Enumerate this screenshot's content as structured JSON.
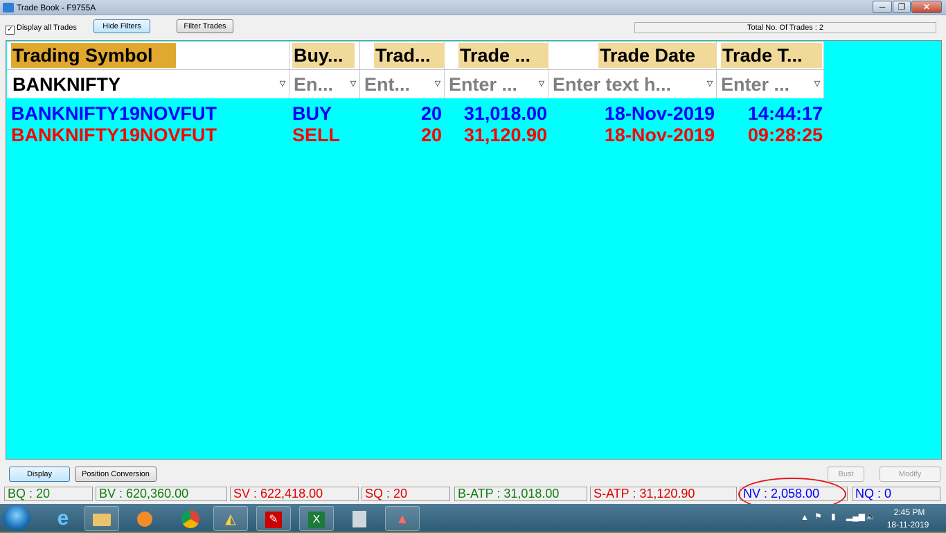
{
  "window": {
    "title": "Trade Book - F9755A",
    "minimize": "─",
    "maximize": "❐",
    "close": "✕"
  },
  "toolbar": {
    "display_all_label": "Display all Trades",
    "display_all_checked": "✓",
    "hide_filters_label": "Hide Filters",
    "filter_trades_label": "Filter Trades",
    "total_trades_label": "Total No. Of Trades : 2"
  },
  "grid": {
    "columns": [
      "Trading Symbol",
      "Buy...",
      "Trad...",
      "Trade ...",
      "Trade Date",
      "Trade T..."
    ],
    "filters": [
      "BANKNIFTY",
      "En...",
      "Ent...",
      "Enter ...",
      "Enter text h...",
      "Enter ..."
    ],
    "filter_icon": "▽",
    "rows": [
      {
        "symbol": "BANKNIFTY19NOVFUT",
        "side": "BUY",
        "qty": "20",
        "price": "31,018.00",
        "date": "18-Nov-2019",
        "time": "14:44:17",
        "color": "#0000ff"
      },
      {
        "symbol": "BANKNIFTY19NOVFUT",
        "side": "SELL",
        "qty": "20",
        "price": "31,120.90",
        "date": "18-Nov-2019",
        "time": "09:28:25",
        "color": "#ff0000"
      }
    ]
  },
  "actions": {
    "display_label": "Display",
    "position_conversion_label": "Position Conversion",
    "bust_label": "Bust",
    "modify_label": "Modify"
  },
  "status": {
    "bq": "BQ : 20",
    "bv": "BV : 620,360.00",
    "sv": "SV : 622,418.00",
    "sq": "SQ : 20",
    "batp": "B-ATP : 31,018.00",
    "satp": "S-ATP : 31,120.90",
    "nv": "NV : 2,058.00",
    "nq": "NQ : 0"
  },
  "taskbar": {
    "apps": [
      "internet-explorer-icon",
      "file-explorer-icon",
      "media-player-icon",
      "chrome-icon",
      "trading-app-icon",
      "pdf-reader-icon",
      "excel-icon",
      "calculator-icon",
      "triangle-app-icon"
    ],
    "time": "2:45 PM",
    "date": "18-11-2019"
  },
  "colors": {
    "grid_background": "#00ffff",
    "buy": "#0000ff",
    "sell": "#ff0000",
    "header_highlight": "#f1d99a"
  }
}
